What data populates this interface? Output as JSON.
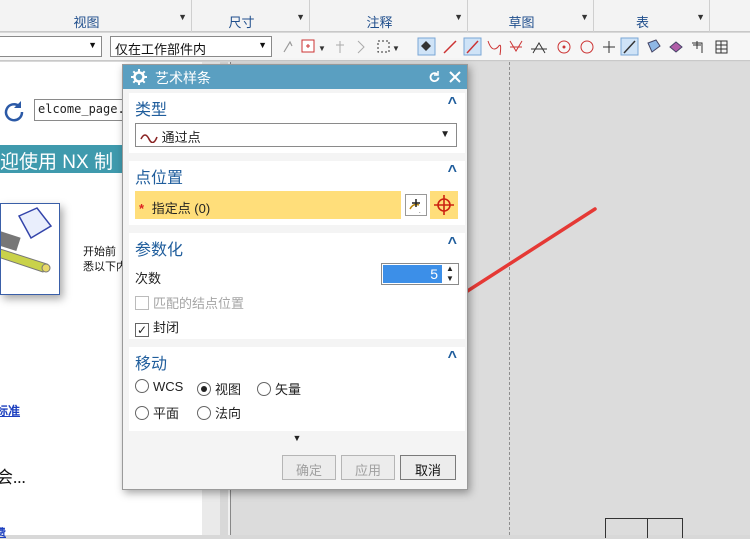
{
  "ribbon": {
    "groups": [
      {
        "label": "视图"
      },
      {
        "label": "尺寸"
      },
      {
        "label": "注释"
      },
      {
        "label": "草图"
      },
      {
        "label": "表"
      }
    ]
  },
  "toolbar": {
    "filter_value": "",
    "scope_value": "仅在工作部件内"
  },
  "welcome": {
    "address": "elcome_page.",
    "banner": "迎使用 NX 制",
    "text_line1": "开始前",
    "text_line2": "悉以下内",
    "link1": "标准",
    "heading": "会...",
    "link2": "费"
  },
  "dialog": {
    "title": "艺术样条",
    "sections": {
      "type": {
        "title": "类型",
        "selected": "通过点"
      },
      "point_position": {
        "title": "点位置",
        "specify_point_label": "指定点 (0)",
        "required_mark": "*"
      },
      "parameterization": {
        "title": "参数化",
        "degree_label": "次数",
        "degree_value": "5",
        "matched_knots_label": "匹配的结点位置",
        "matched_knots_checked": false,
        "closed_label": "封闭",
        "closed_checked": true
      },
      "move": {
        "title": "移动",
        "options": [
          "WCS",
          "视图",
          "矢量",
          "平面",
          "法向"
        ],
        "selected": "视图"
      }
    },
    "buttons": {
      "ok": "确定",
      "apply": "应用",
      "cancel": "取消"
    }
  },
  "colors": {
    "title_bar": "#5a9fc1",
    "section_title": "#1f5d9c",
    "highlight_row": "#ffde7a",
    "spinner_value_bg": "#3c8fe8",
    "annotation_arrow": "#e53935",
    "banner": "#3f9aad"
  },
  "icons": [
    "refresh-icon",
    "settings-gear-icon",
    "reset-icon",
    "close-icon",
    "spline-icon",
    "point-dialog-icon",
    "point-snap-icon",
    "collapse-icon",
    "more-options-icon"
  ]
}
